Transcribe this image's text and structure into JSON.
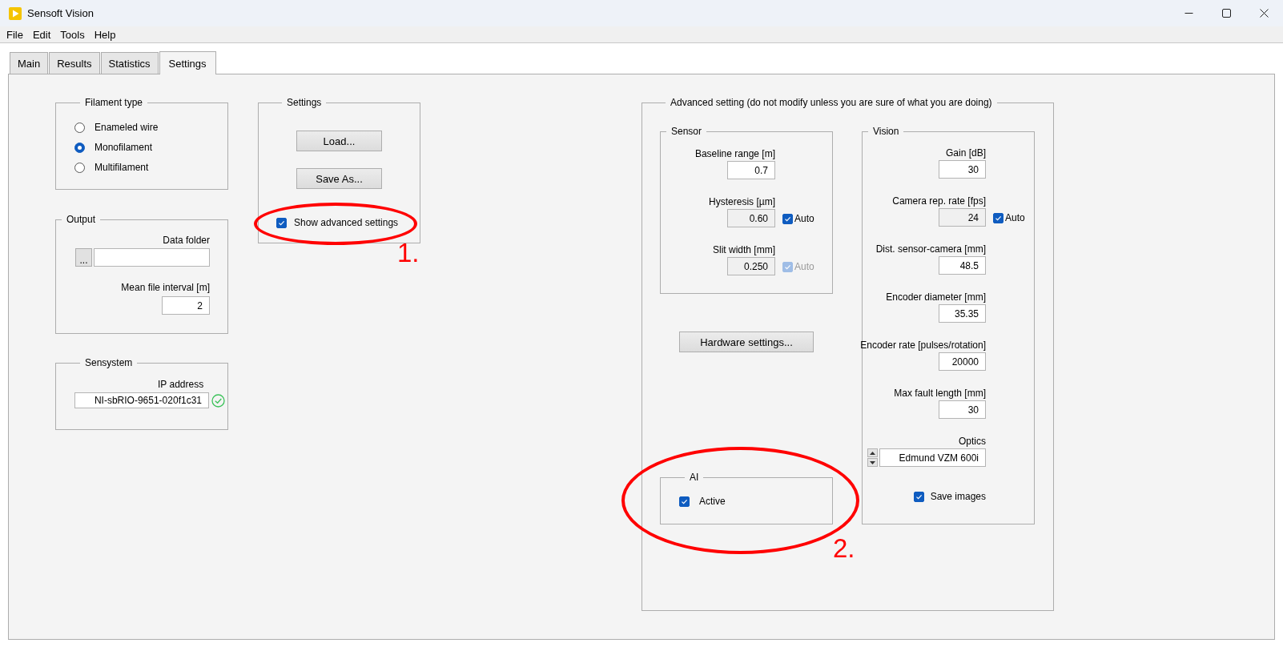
{
  "window": {
    "title": "Sensoft Vision"
  },
  "menu": [
    "File",
    "Edit",
    "Tools",
    "Help"
  ],
  "tabs": [
    {
      "label": "Main",
      "selected": false
    },
    {
      "label": "Results",
      "selected": false
    },
    {
      "label": "Statistics",
      "selected": false
    },
    {
      "label": "Settings",
      "selected": true
    }
  ],
  "filament_type": {
    "title": "Filament type",
    "options": [
      {
        "label": "Enameled wire",
        "selected": false
      },
      {
        "label": "Monofilament",
        "selected": true
      },
      {
        "label": "Multifilament",
        "selected": false
      }
    ]
  },
  "output": {
    "title": "Output",
    "data_folder": {
      "label": "Data folder",
      "browse_button": "..."
    },
    "mean_file_interval": {
      "label": "Mean file interval [m]",
      "value": "2"
    }
  },
  "sensystem": {
    "title": "Sensystem",
    "ip_address": {
      "label": "IP address",
      "value": "NI-sbRIO-9651-020f1c31",
      "valid": true
    }
  },
  "settings": {
    "title": "Settings",
    "buttons": [
      "Load...",
      "Save As..."
    ],
    "show_advanced": {
      "label": "Show advanced settings",
      "checked": true
    }
  },
  "advanced": {
    "title": "Advanced setting (do not modify unless you are sure of what you are doing)",
    "sensor": {
      "title": "Sensor",
      "fields": [
        {
          "label": "Baseline range [m]",
          "value": "0.7",
          "disabled": false
        },
        {
          "label": "Hysteresis [µm]",
          "value": "0.60",
          "disabled": true,
          "auto": {
            "label": "Auto",
            "checked": true,
            "disabled": false
          }
        },
        {
          "label": "Slit width [mm]",
          "value": "0.250",
          "disabled": true,
          "auto": {
            "label": "Auto",
            "checked": true,
            "disabled": true
          }
        }
      ]
    },
    "hardware_button": "Hardware settings...",
    "ai": {
      "title": "AI",
      "active": {
        "label": "Active",
        "checked": true
      }
    },
    "vision": {
      "title": "Vision",
      "fields": [
        {
          "label": "Gain [dB]",
          "value": "30",
          "disabled": false
        },
        {
          "label": "Camera rep. rate [fps]",
          "value": "24",
          "disabled": true,
          "auto": {
            "label": "Auto",
            "checked": true,
            "disabled": false
          }
        },
        {
          "label": "Dist. sensor-camera [mm]",
          "value": "48.5",
          "disabled": false
        },
        {
          "label": "Encoder diameter [mm]",
          "value": "35.35",
          "disabled": false
        },
        {
          "label": "Encoder rate [pulses/rotation]",
          "value": "20000",
          "disabled": false
        },
        {
          "label": "Max fault length [mm]",
          "value": "30",
          "disabled": false
        }
      ],
      "optics": {
        "label": "Optics",
        "value": "Edmund VZM 600i"
      },
      "save_images": {
        "label": "Save images",
        "checked": true
      }
    }
  },
  "annotations": [
    {
      "label": "1."
    },
    {
      "label": "2."
    }
  ]
}
